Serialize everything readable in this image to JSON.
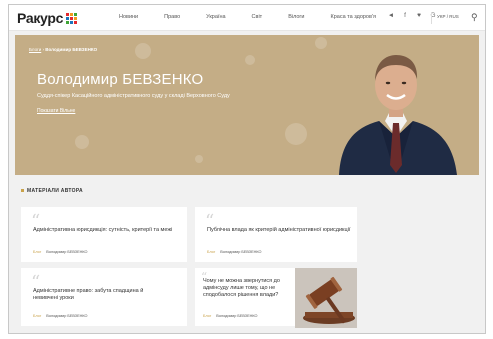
{
  "header": {
    "logo": "Ракурс",
    "nav": [
      "Новини",
      "Право",
      "Україна",
      "Світ",
      "Вілоги",
      "Краса та здоров'я"
    ],
    "social_icons": [
      "telegram-icon",
      "facebook-icon",
      "twitter-icon",
      "google-icon"
    ],
    "social_glyphs": [
      "◄",
      "f",
      "♥",
      "G"
    ],
    "lang": "УКР / RUS"
  },
  "hero": {
    "breadcrumb_home": "Блоги",
    "breadcrumb_current": "Володимир БЕВЗЕНКО",
    "name": "Володимир БЕВЗЕНКО",
    "subtitle": "Суддя-спікер Касаційного адміністративного суду у складі Верховного Суду",
    "show_all": "Показати Вільне"
  },
  "section": {
    "title": "МАТЕРІАЛИ АВТОРА"
  },
  "cards": [
    {
      "title": "Адміністративна юрисдикція: сутність, критерії та межі",
      "tag": "Блог",
      "author": "Володимир БЕВЗЕНКО"
    },
    {
      "title": "Публічна влада як критерій адміністративної юрисдикції",
      "tag": "Блог",
      "author": "Володимир БЕВЗЕНКО"
    },
    {
      "title": "Адміністративне право: забута спадщина й невивчені уроки",
      "tag": "Блог",
      "author": "Володимир БЕВЗЕНКО"
    },
    {
      "title": "Чому не можна звернутися до адмінсуду лише тому, що не сподобалося рішення влади?",
      "tag": "Блог",
      "author": "Володимир БЕВЗЕНКО"
    }
  ],
  "colors": {
    "hero_bg": "#c4ad86",
    "accent": "#c9a24a"
  }
}
